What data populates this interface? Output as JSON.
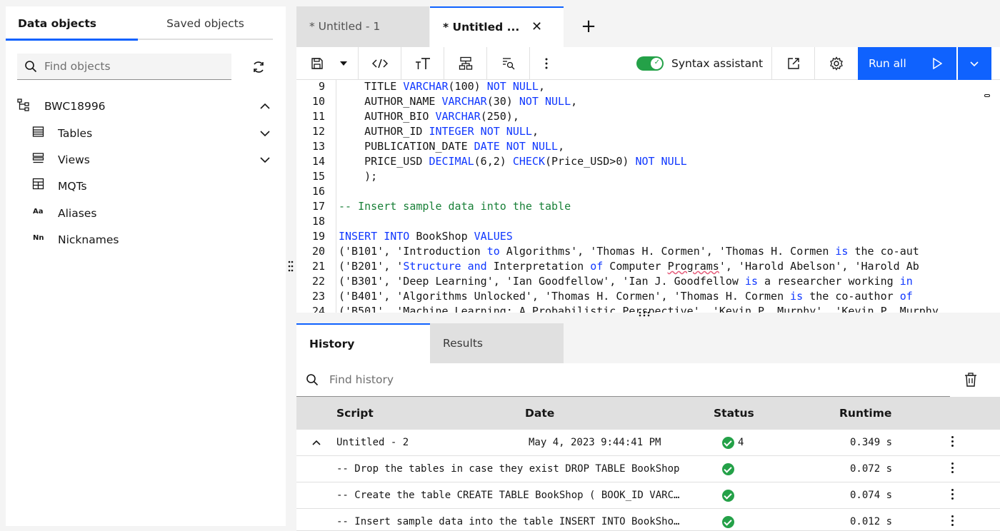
{
  "left_panel": {
    "tabs": [
      "Data objects",
      "Saved objects"
    ],
    "search_placeholder": "Find objects",
    "schema": "BWC18996",
    "items": [
      {
        "label": "Tables",
        "icon": "table-list-icon",
        "chevron": true
      },
      {
        "label": "Views",
        "icon": "view-list-icon",
        "chevron": true
      },
      {
        "label": "MQTs",
        "icon": "grid-table-icon",
        "chevron": false
      },
      {
        "label": "Aliases",
        "icon": "alias-icon",
        "chevron": false
      },
      {
        "label": "Nicknames",
        "icon": "nickname-icon",
        "chevron": false
      }
    ],
    "alias_glyph": "Aa",
    "nickname_glyph": "Nn"
  },
  "editor_tabs": {
    "tab1": "* Untitled - 1",
    "tab2": "* Untitled ...",
    "close": "✕",
    "add": "+"
  },
  "toolbar": {
    "syntax_assistant": "Syntax assistant",
    "run_all": "Run all",
    "toggle_on": true
  },
  "code": {
    "line_numbers": [
      "9",
      "10",
      "11",
      "12",
      "13",
      "14",
      "15",
      "16",
      "17",
      "18",
      "19",
      "20",
      "21",
      "22",
      "23",
      "24"
    ]
  },
  "bottom_panel": {
    "tabs": [
      "History",
      "Results"
    ],
    "search_placeholder": "Find history",
    "columns": [
      "Script",
      "Date",
      "Status",
      "Runtime"
    ],
    "rows": [
      {
        "script": "Untitled - 2",
        "date": "May 4, 2023 9:44:41 PM",
        "status_count": "4",
        "runtime": "0.349 s"
      },
      {
        "script": "-- Drop the tables in case they exist DROP TABLE BookShop",
        "date": "",
        "status_count": "",
        "runtime": "0.072 s"
      },
      {
        "script": "-- Create the table CREATE TABLE BookShop ( BOOK_ID VARC…",
        "date": "",
        "status_count": "",
        "runtime": "0.074 s"
      },
      {
        "script": "-- Insert sample data into the table INSERT INTO BookSho…",
        "date": "",
        "status_count": "",
        "runtime": "0.012 s"
      }
    ]
  },
  "colors": {
    "accent": "#0f62fe",
    "success": "#24a148",
    "keyword": "#0f37ff",
    "comment": "#198038"
  }
}
